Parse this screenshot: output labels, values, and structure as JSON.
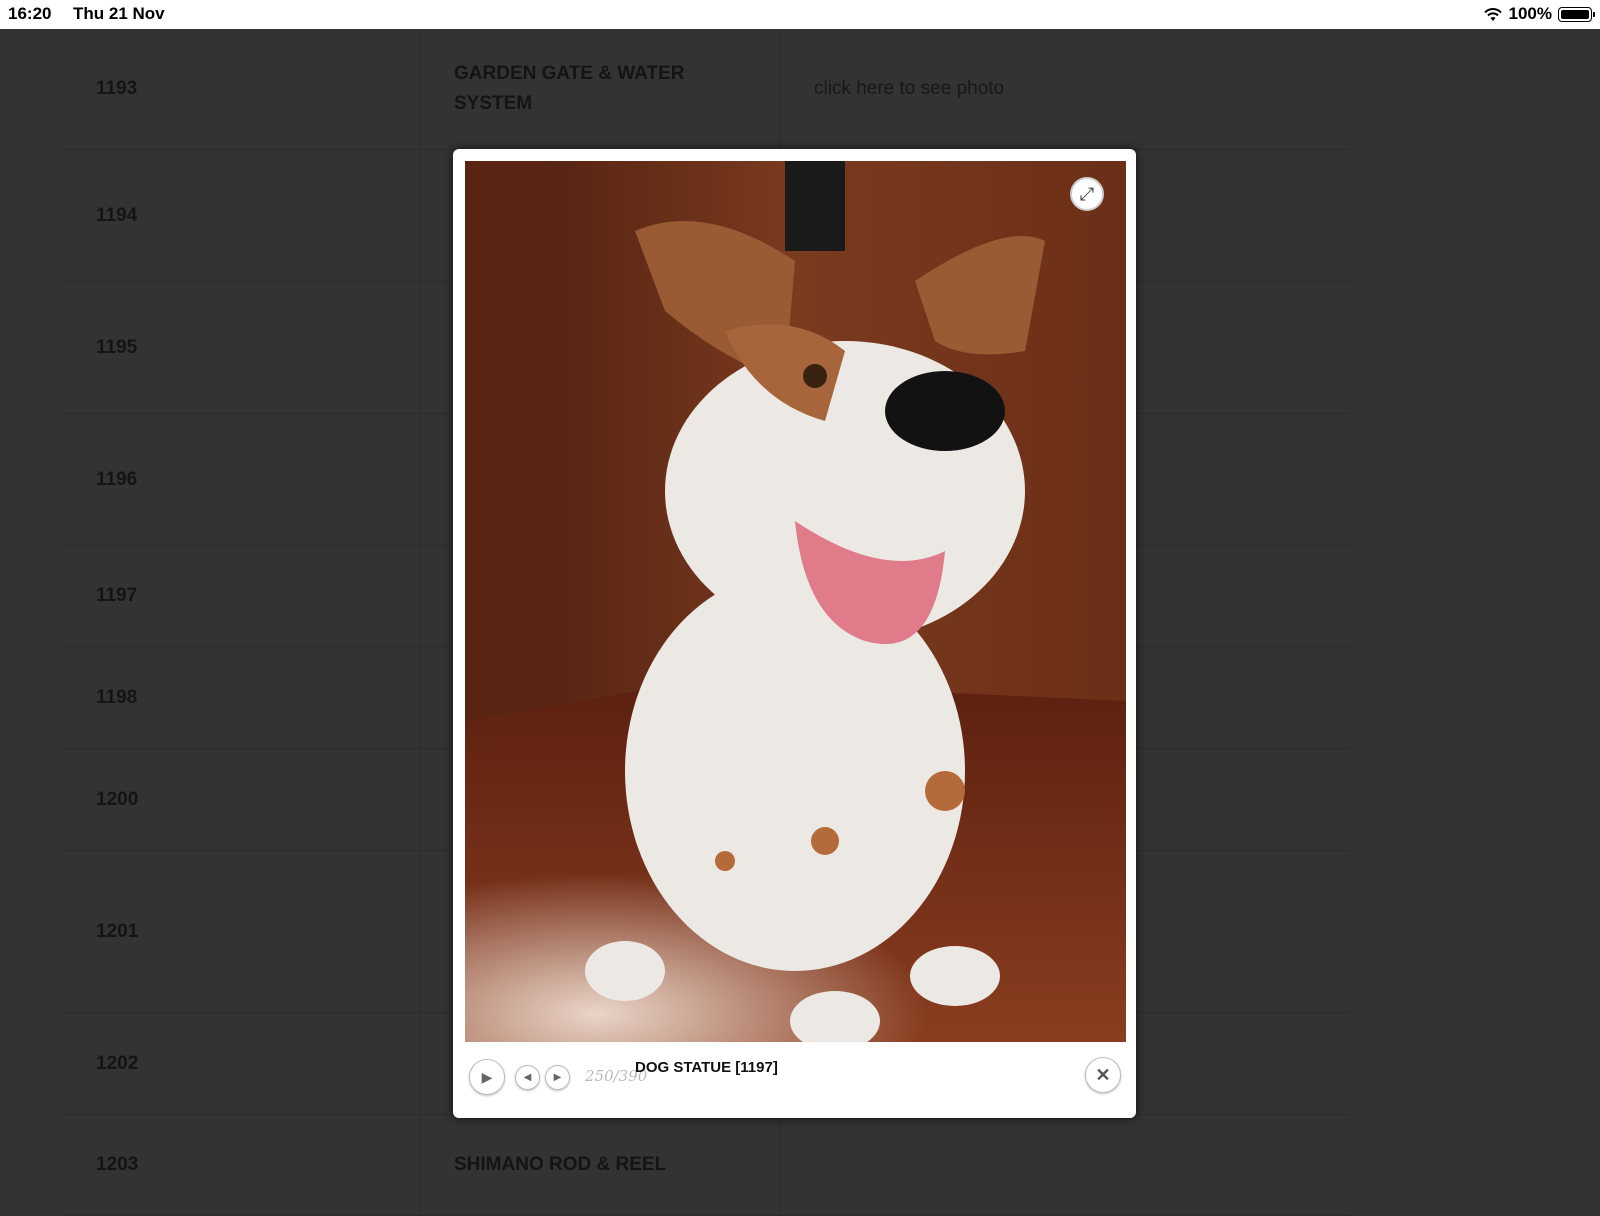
{
  "status_bar": {
    "time": "16:20",
    "date": "Thu 21 Nov",
    "battery": "100%"
  },
  "table": {
    "rows": [
      {
        "lot": "1193",
        "description": "GARDEN GATE & WATER SYSTEM",
        "photo_link": "click here to see photo"
      },
      {
        "lot": "1194",
        "description": "",
        "photo_link": ""
      },
      {
        "lot": "1195",
        "description": "",
        "photo_link": ""
      },
      {
        "lot": "1196",
        "description": "",
        "photo_link": ""
      },
      {
        "lot": "1197",
        "description": "",
        "photo_link": ""
      },
      {
        "lot": "1198",
        "description": "",
        "photo_link": ""
      },
      {
        "lot": "1200",
        "description": "",
        "photo_link": ""
      },
      {
        "lot": "1201",
        "description": "",
        "photo_link": ""
      },
      {
        "lot": "1202",
        "description": "",
        "photo_link": ""
      },
      {
        "lot": "1203",
        "description": "SHIMANO ROD & REEL",
        "photo_link": ""
      }
    ]
  },
  "lightbox": {
    "counter": "250/390",
    "caption": "DOG STATUE [1197]",
    "icons": {
      "expand": "expand-icon",
      "play": "play-icon",
      "prev": "prev-icon",
      "next": "next-icon",
      "close": "close-icon"
    }
  },
  "colors": {
    "overlay_bg": "#333333",
    "status_bar_bg": "#ffffff",
    "lightbox_bg": "#ffffff",
    "text_dark": "#141414"
  }
}
